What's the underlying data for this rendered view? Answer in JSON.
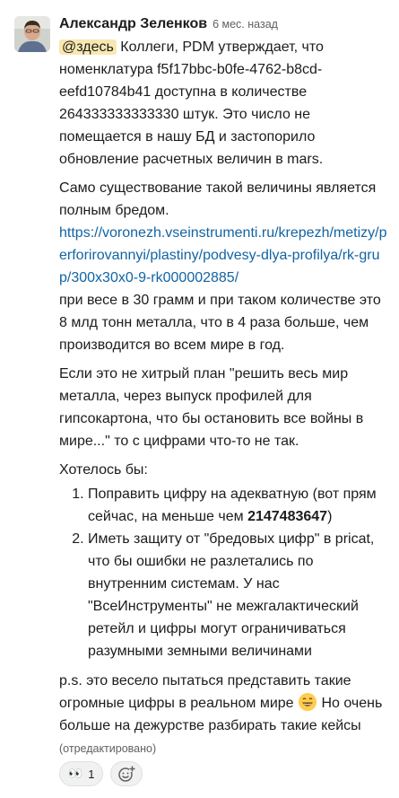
{
  "message": {
    "author": "Александр Зеленков",
    "time": "6 мес. назад",
    "p1": {
      "mention": "@здесь",
      "text": " Коллеги, PDM утверждает, что номенклатура f5f17bbc-b0fe-4762-b8cd-eefd10784b41 доступна в количестве 264333333333330 штук. Это число не помещается в нашу БД и застопорило обновление расчетных величин в mars."
    },
    "p2": {
      "text": "Само существование такой величины является полным бредом.",
      "link": "https://voronezh.vseinstrumenti.ru/krepezh/metizy/perforirovannyi/plastiny/podvesy-dlya-profilya/rk-grup/300x30x0-9-rk000002885/",
      "after": "при весе в 30 грамм и при таком количестве это 8 млд тонн металла, что в 4 раза больше, чем производится во всем мире в год."
    },
    "p3": "Если это не хитрый план \"решить весь мир металла, через выпуск профилей для гипсокартона, что бы остановить все войны в мире...\" то с цифрами что-то не так.",
    "p4": "Хотелось бы:",
    "list": {
      "item1_before": "Поправить цифру на адекватную (вот прям сейчас, на меньше чем ",
      "item1_bold": "2147483647",
      "item1_after": ")",
      "item2": "Иметь защиту от \"бредовых цифр\" в pricat, что бы ошибки не разлетались по внутренним системам. У нас \"ВсеИнструменты\" не межгалактический ретейл и цифры могут ограничиваться разумными земными величинами"
    },
    "p5": {
      "before": "p.s. это весело пытаться представить такие огромные цифры в реальном мире ",
      "emoji_icon": "grinning-face-icon",
      "after": " Но очень больше на дежурстве разбирать такие кейсы ",
      "edited": "(отредактировано)"
    }
  },
  "reactions": [
    {
      "icon": "eyes-icon",
      "glyph": "👀",
      "count": "1"
    }
  ],
  "add_reaction_icon": "add-reaction-icon",
  "colors": {
    "link": "#1264a3",
    "mention_bg": "#f8e8b0",
    "muted": "#616061"
  }
}
